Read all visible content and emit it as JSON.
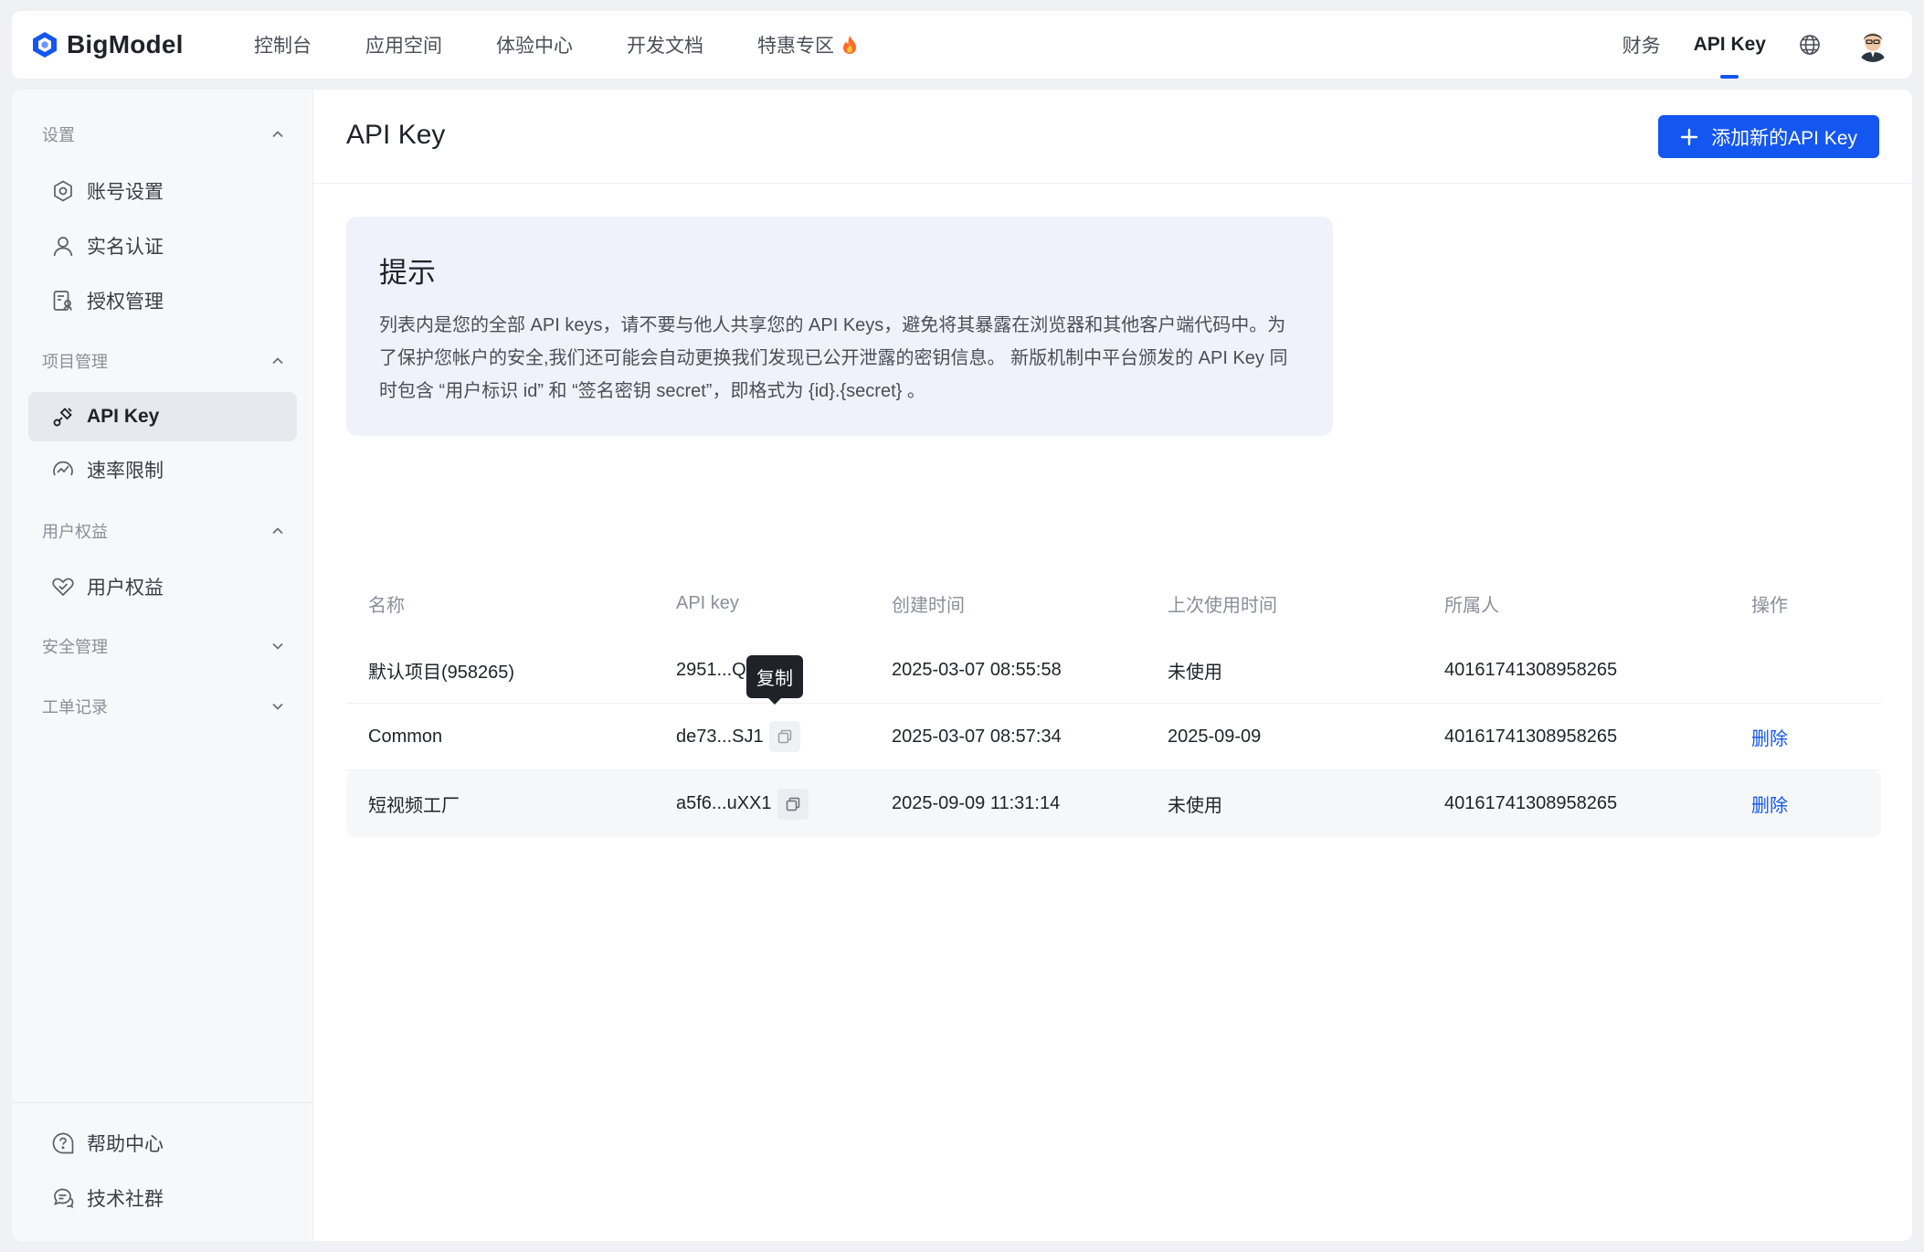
{
  "brand": {
    "name": "BigModel",
    "accent": "#1456f0"
  },
  "topnav": {
    "links": [
      {
        "label": "控制台"
      },
      {
        "label": "应用空间"
      },
      {
        "label": "体验中心"
      },
      {
        "label": "开发文档"
      },
      {
        "label": "特惠专区",
        "icon": "fire-icon"
      }
    ],
    "right": {
      "finance": "财务",
      "api_key": "API Key",
      "globe_icon": "globe-icon",
      "avatar_icon": "avatar"
    }
  },
  "sidebar": {
    "groups": [
      {
        "title": "设置",
        "expanded": true,
        "items": [
          {
            "label": "账号设置",
            "icon": "settings-icon"
          },
          {
            "label": "实名认证",
            "icon": "user-icon"
          },
          {
            "label": "授权管理",
            "icon": "auth-doc-icon"
          }
        ]
      },
      {
        "title": "项目管理",
        "expanded": true,
        "items": [
          {
            "label": "API Key",
            "icon": "key-plug-icon",
            "active": true
          },
          {
            "label": "速率限制",
            "icon": "gauge-icon"
          }
        ]
      },
      {
        "title": "用户权益",
        "expanded": true,
        "items": [
          {
            "label": "用户权益",
            "icon": "heart-badge-icon"
          }
        ]
      },
      {
        "title": "安全管理",
        "expanded": false,
        "items": []
      },
      {
        "title": "工单记录",
        "expanded": false,
        "items": []
      }
    ],
    "footer": [
      {
        "label": "帮助中心",
        "icon": "help-icon"
      },
      {
        "label": "技术社群",
        "icon": "chat-icon"
      }
    ]
  },
  "main": {
    "title": "API Key",
    "add_button": "添加新的API Key",
    "tip": {
      "title": "提示",
      "body": "列表内是您的全部 API keys，请不要与他人共享您的 API Keys，避免将其暴露在浏览器和其他客户端代码中。为了保护您帐户的安全,我们还可能会自动更换我们发现已公开泄露的密钥信息。 新版机制中平台颁发的 API Key 同时包含 “用户标识 id” 和 “签名密钥 secret”，即格式为 {id}.{secret} 。"
    },
    "table": {
      "headers": [
        "名称",
        "API key",
        "创建时间",
        "上次使用时间",
        "所属人",
        "操作"
      ],
      "rows": [
        {
          "name": "默认项目(958265)",
          "key": "2951...Qsnl",
          "created": "2025-03-07 08:55:58",
          "last_used": "未使用",
          "owner": "40161741308958265",
          "op": ""
        },
        {
          "name": "Common",
          "key": "de73...SJ1",
          "created": "2025-03-07 08:57:34",
          "last_used": "2025-09-09",
          "owner": "40161741308958265",
          "op": "删除"
        },
        {
          "name": "短视频工厂",
          "key": "a5f6...uXX1",
          "created": "2025-09-09 11:31:14",
          "last_used": "未使用",
          "owner": "40161741308958265",
          "op": "删除"
        }
      ],
      "tooltip": "复制"
    }
  }
}
